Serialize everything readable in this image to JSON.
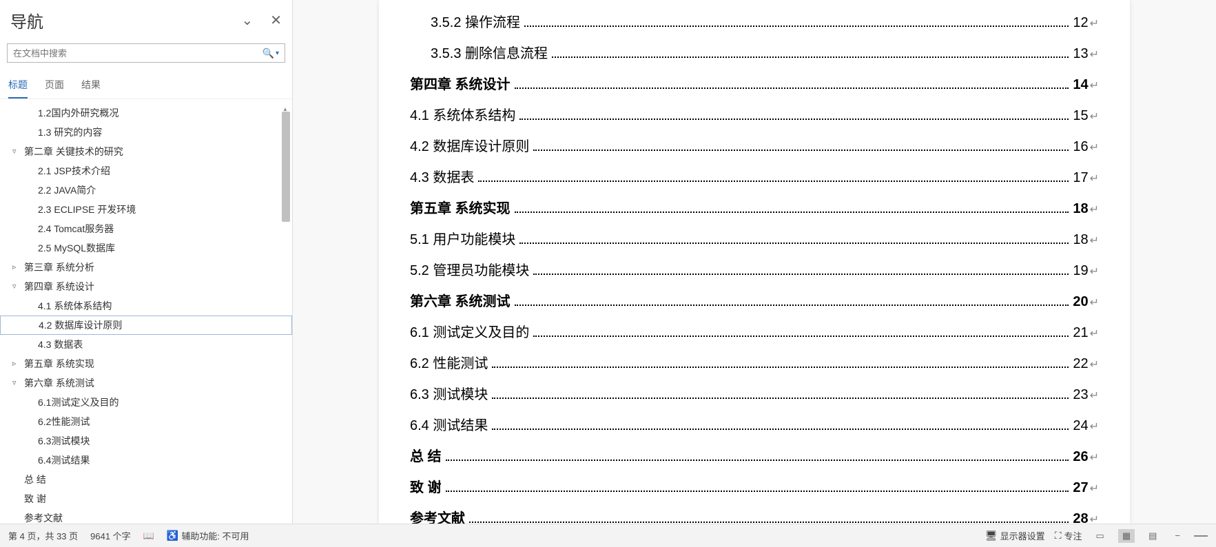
{
  "nav": {
    "title": "导航",
    "search_placeholder": "在文档中搜索",
    "tabs": {
      "headings": "标题",
      "pages": "页面",
      "results": "结果"
    },
    "tree": [
      {
        "text": "1.2国内外研究概况",
        "level": 1
      },
      {
        "text": "1.3 研究的内容",
        "level": 1
      },
      {
        "text": "第二章 关键技术的研究",
        "level": 0,
        "arrow": "▿"
      },
      {
        "text": "2.1 JSP技术介绍",
        "level": 1
      },
      {
        "text": "2.2 JAVA简介",
        "level": 1
      },
      {
        "text": "2.3 ECLIPSE 开发环境",
        "level": 1
      },
      {
        "text": "2.4 Tomcat服务器",
        "level": 1
      },
      {
        "text": "2.5 MySQL数据库",
        "level": 1
      },
      {
        "text": "第三章 系统分析",
        "level": 0,
        "arrow": "▹"
      },
      {
        "text": "第四章 系统设计",
        "level": 0,
        "arrow": "▿"
      },
      {
        "text": "4.1 系统体系结构",
        "level": 1
      },
      {
        "text": "4.2 数据库设计原则",
        "level": 1,
        "selected": true
      },
      {
        "text": "4.3 数据表",
        "level": 1
      },
      {
        "text": "第五章 系统实现",
        "level": 0,
        "arrow": "▹"
      },
      {
        "text": "第六章  系统测试",
        "level": 0,
        "arrow": "▿"
      },
      {
        "text": "6.1测试定义及目的",
        "level": 1
      },
      {
        "text": "6.2性能测试",
        "level": 1
      },
      {
        "text": "6.3测试模块",
        "level": 1
      },
      {
        "text": "6.4测试结果",
        "level": 1
      },
      {
        "text": "总 结",
        "level": 0
      },
      {
        "text": "致 谢",
        "level": 0
      },
      {
        "text": "参考文献",
        "level": 0
      }
    ]
  },
  "toc": [
    {
      "text": "3.5.2 操作流程",
      "page": "12",
      "indent": 1
    },
    {
      "text": "3.5.3 删除信息流程",
      "page": "13",
      "indent": 1
    },
    {
      "text": "第四章 系统设计",
      "page": "14",
      "bold": true
    },
    {
      "text": "4.1 系统体系结构",
      "page": "15"
    },
    {
      "text": "4.2 数据库设计原则",
      "page": "16"
    },
    {
      "text": "4.3 数据表",
      "page": "17"
    },
    {
      "text": "第五章 系统实现",
      "page": "18",
      "bold": true
    },
    {
      "text": "5.1 用户功能模块",
      "page": "18"
    },
    {
      "text": "5.2 管理员功能模块",
      "page": "19"
    },
    {
      "text": "第六章  系统测试",
      "page": "20",
      "bold": true
    },
    {
      "text": "6.1 测试定义及目的",
      "page": "21"
    },
    {
      "text": "6.2 性能测试",
      "page": "22"
    },
    {
      "text": "6.3 测试模块",
      "page": "23"
    },
    {
      "text": "6.4 测试结果",
      "page": "24"
    },
    {
      "text": "总  结",
      "page": "26",
      "bold": true
    },
    {
      "text": "致  谢",
      "page": "27",
      "bold": true
    },
    {
      "text": "参考文献",
      "page": "28",
      "bold": true
    }
  ],
  "status": {
    "page": "第 4 页，共 33 页",
    "words": "9641 个字",
    "accessibility": "辅助功能: 不可用",
    "display_settings": "显示器设置",
    "focus": "专注"
  }
}
